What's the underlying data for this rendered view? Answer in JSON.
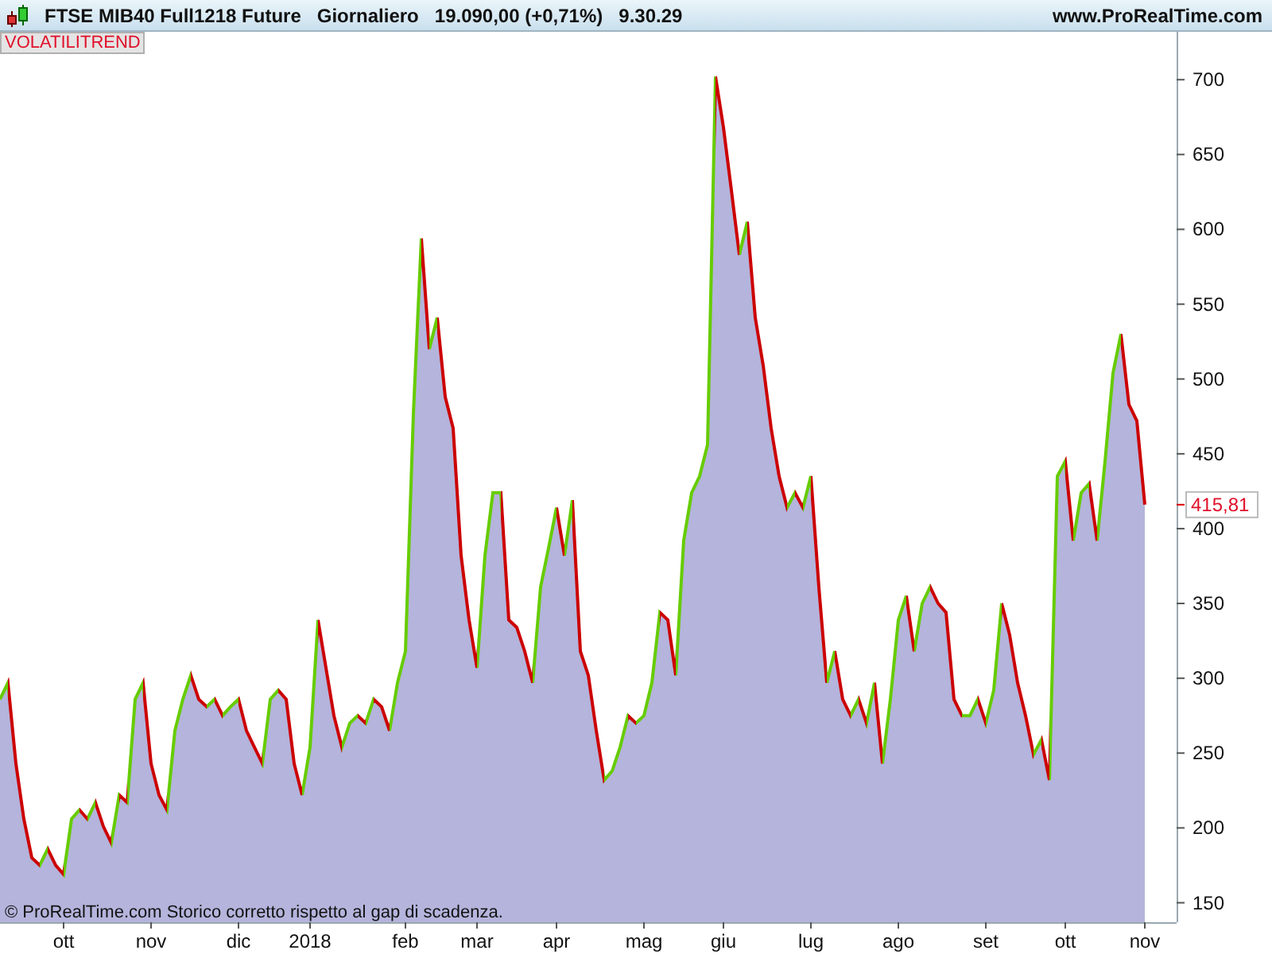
{
  "header": {
    "instrument": "FTSE MIB40 Full1218 Future",
    "period": "Giornaliero",
    "price": "19.090,00 (+0,71%)",
    "time": "9.30.29",
    "site": "www.ProRealTime.com"
  },
  "footer_note": "© ProRealTime.com  Storico corretto rispetto al gap di scadenza.",
  "last_value": "415,81",
  "chart_data": {
    "type": "area",
    "ylim": [
      137,
      732
    ],
    "yticks": [
      150,
      200,
      250,
      300,
      350,
      400,
      450,
      500,
      550,
      600,
      650,
      700
    ],
    "categories": [
      null,
      null,
      null,
      null,
      null,
      null,
      null,
      null,
      "ott",
      null,
      null,
      null,
      null,
      null,
      null,
      null,
      null,
      null,
      null,
      "nov",
      null,
      null,
      null,
      null,
      null,
      null,
      null,
      null,
      null,
      null,
      "dic",
      null,
      null,
      null,
      null,
      null,
      null,
      null,
      null,
      "2018",
      null,
      null,
      null,
      null,
      null,
      null,
      null,
      null,
      null,
      null,
      null,
      "feb",
      null,
      null,
      null,
      null,
      null,
      null,
      null,
      null,
      "mar",
      null,
      null,
      null,
      null,
      null,
      null,
      null,
      null,
      null,
      "apr",
      null,
      null,
      null,
      null,
      null,
      null,
      null,
      null,
      null,
      null,
      "mag",
      null,
      null,
      null,
      null,
      null,
      null,
      null,
      null,
      null,
      "giu",
      null,
      null,
      null,
      null,
      null,
      null,
      null,
      null,
      null,
      null,
      "lug",
      null,
      null,
      null,
      null,
      null,
      null,
      null,
      null,
      null,
      null,
      "ago",
      null,
      null,
      null,
      null,
      null,
      null,
      null,
      null,
      null,
      null,
      "set",
      null,
      null,
      null,
      null,
      null,
      null,
      null,
      null,
      null,
      "ott",
      null,
      null,
      null,
      null,
      null,
      null,
      null,
      null,
      null,
      "nov"
    ],
    "series": [
      {
        "name": "VOLATILITREND",
        "color": "#b4b4dc",
        "values": [
          286,
          297,
          243,
          206,
          180,
          175,
          186,
          175,
          169,
          206,
          212,
          206,
          217,
          201,
          190,
          222,
          217,
          286,
          297,
          243,
          222,
          212,
          265,
          286,
          302,
          286,
          281,
          286,
          275,
          281,
          286,
          265,
          254,
          243,
          286,
          292,
          286,
          243,
          222,
          254,
          339,
          307,
          275,
          254,
          270,
          275,
          270,
          286,
          281,
          265,
          297,
          318,
          477,
          594,
          520,
          541,
          488,
          467,
          382,
          339,
          307,
          382,
          424,
          424,
          339,
          334,
          318,
          297,
          361,
          387,
          414,
          382,
          419,
          318,
          302,
          265,
          232,
          238,
          254,
          275,
          270,
          275,
          297,
          344,
          339,
          302,
          392,
          424,
          435,
          456,
          702,
          668,
          626,
          583,
          605,
          541,
          509,
          467,
          435,
          414,
          424,
          414,
          435,
          361,
          297,
          318,
          286,
          275,
          286,
          270,
          297,
          243,
          286,
          339,
          355,
          318,
          350,
          361,
          350,
          344,
          286,
          275,
          275,
          286,
          270,
          292,
          350,
          329,
          297,
          275,
          249,
          259,
          232,
          435,
          445,
          392,
          424,
          430,
          392,
          445,
          504,
          530,
          483,
          472,
          416
        ]
      }
    ]
  }
}
